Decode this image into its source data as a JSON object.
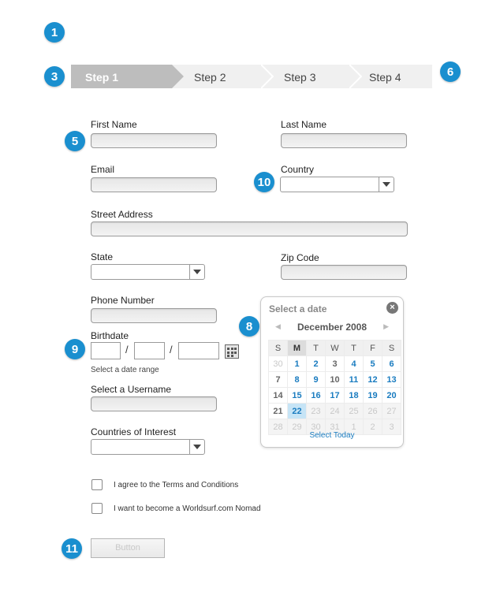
{
  "badges": {
    "b1": "1",
    "b3": "3",
    "b6": "6",
    "b5": "5",
    "b10": "10",
    "b9": "9",
    "b8": "8",
    "b11": "11"
  },
  "steps": [
    "Step 1",
    "Step 2",
    "Step 3",
    "Step 4"
  ],
  "labels": {
    "first_name": "First Name",
    "last_name": "Last Name",
    "email": "Email",
    "country": "Country",
    "street": "Street Address",
    "state": "State",
    "zip": "Zip Code",
    "phone": "Phone Number",
    "birthdate": "Birthdate",
    "birthdate_hint": "Select a date range",
    "username": "Select a Username",
    "countries_interest": "Countries of Interest"
  },
  "birthdate_sep": "/",
  "checkboxes": [
    "I agree to the Terms and Conditions",
    "I want to become a Worldsurf.com Nomad"
  ],
  "button_label": "Button",
  "calendar": {
    "title": "Select a date",
    "close": "×",
    "month": "December 2008",
    "prev": "◀",
    "next": "▶",
    "weekdays": [
      "S",
      "M",
      "T",
      "W",
      "T",
      "F",
      "S"
    ],
    "weeks": [
      [
        "30",
        "1",
        "2",
        "3",
        "4",
        "5",
        "6"
      ],
      [
        "7",
        "8",
        "9",
        "10",
        "11",
        "12",
        "13"
      ],
      [
        "14",
        "15",
        "16",
        "17",
        "18",
        "19",
        "20"
      ],
      [
        "21",
        "22",
        "23",
        "24",
        "25",
        "26",
        "27"
      ],
      [
        "28",
        "29",
        "30",
        "31",
        "1",
        "2",
        "3"
      ]
    ],
    "today_label": "Select Today",
    "selected_day": "22"
  },
  "colors": {
    "accent": "#1a8fcf",
    "link": "#1a7cc0",
    "step_active": "#bdbdbd"
  }
}
